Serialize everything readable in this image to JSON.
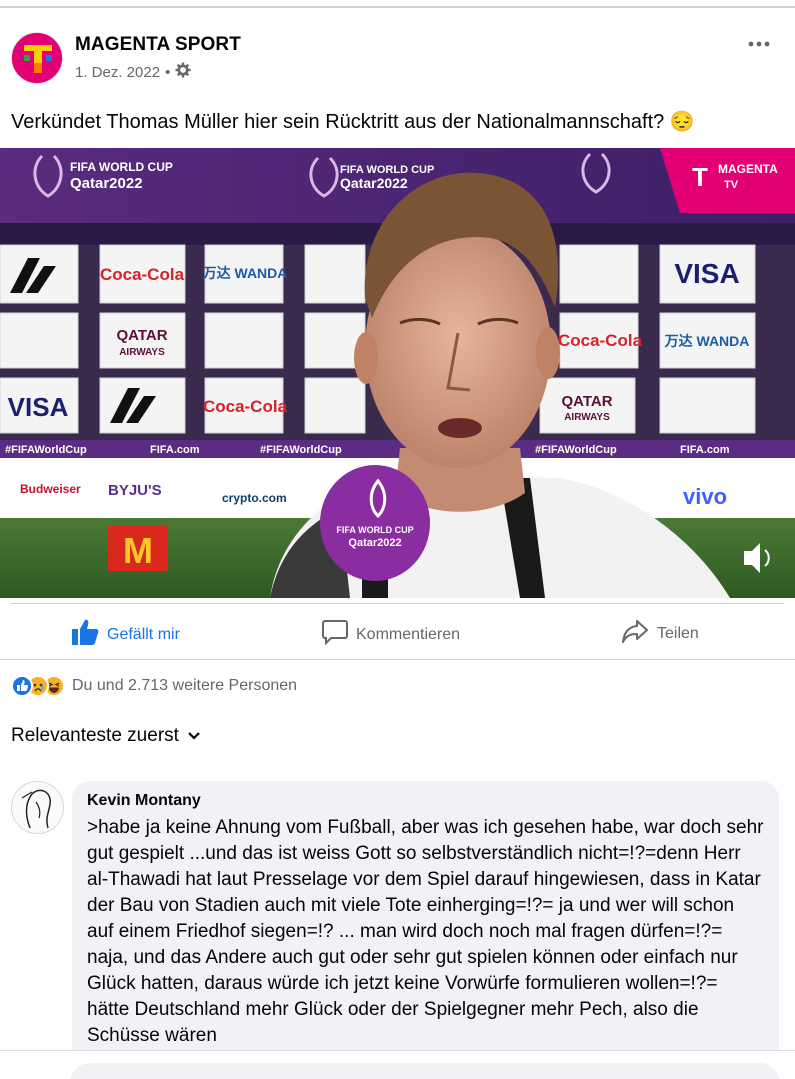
{
  "post": {
    "page_name": "MAGENTA SPORT",
    "date": "1. Dez. 2022",
    "separator": "•",
    "text": "Verkündet Thomas Müller hier sein Rücktritt aus der Nationalmannschaft? 😔"
  },
  "video": {
    "broadcaster": "MAGENTA",
    "broadcaster_sub": "TV",
    "event_line1": "FIFA WORLD CUP",
    "event_line2": "Qatar2022",
    "mic_line1": "FIFA WORLD CUP",
    "mic_line2": "Qatar2022",
    "hashtag": "#FIFAWorldCup",
    "site": "FIFA.com",
    "sponsors": [
      "Coca-Cola",
      "万达 WANDA",
      "VISA",
      "QATAR AIRWAYS",
      "BYJU'S",
      "crypto.com",
      "vivo",
      "Budweiser"
    ]
  },
  "actions": {
    "like": "Gefällt mir",
    "comment": "Kommentieren",
    "share": "Teilen"
  },
  "reactions": {
    "text": "Du und 2.713 weitere Personen"
  },
  "sort": {
    "label": "Relevanteste zuerst"
  },
  "comment": {
    "author": "Kevin Montany",
    "text": ">habe ja keine Ahnung vom Fußball, aber was ich gesehen habe, war doch sehr gut gespielt ...und das ist weiss Gott so selbstverständlich nicht=!?=denn Herr al-Thawadi hat laut Presselage vor dem Spiel darauf hingewiesen, dass in Katar der Bau von Stadien auch mit viele Tote einherging=!?=  ja und wer will schon auf einem Friedhof siegen=!? ... man wird doch noch mal fragen dürfen=!?= naja, und das Andere auch gut oder sehr gut spielen können oder einfach nur Glück hatten, daraus würde ich jetzt keine Vorwürfe formulieren wollen=!?= hätte Deutschland mehr Glück oder der Spielgegner mehr Pech, also die Schüsse wären"
  },
  "colors": {
    "brand": "#e20074",
    "facebook_blue": "#1b74e4",
    "secondary_text": "#65676b",
    "bubble": "#f0f2f5"
  }
}
